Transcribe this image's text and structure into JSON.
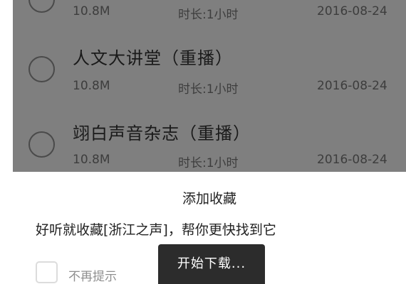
{
  "list": {
    "items": [
      {
        "title": "",
        "size": "10.8M",
        "duration": "时长:1小时",
        "date": "2016-08-24"
      },
      {
        "title": "人文大讲堂（重播）",
        "size": "10.8M",
        "duration": "时长:1小时",
        "date": "2016-08-24"
      },
      {
        "title": "翊白声音杂志（重播）",
        "size": "10.8M",
        "duration": "时长:1小时",
        "date": "2016-08-24"
      }
    ]
  },
  "dialog": {
    "title": "添加收藏",
    "message": "好听就收藏[浙江之声]，帮你更快找到它",
    "checkbox_label": "不再提示",
    "checkbox_checked": false
  },
  "toast": {
    "text": "开始下载..."
  },
  "colors": {
    "overlay": "#7f7f7f",
    "dialog_background": "#ffffff",
    "toast_background": "#2c2c2c"
  }
}
